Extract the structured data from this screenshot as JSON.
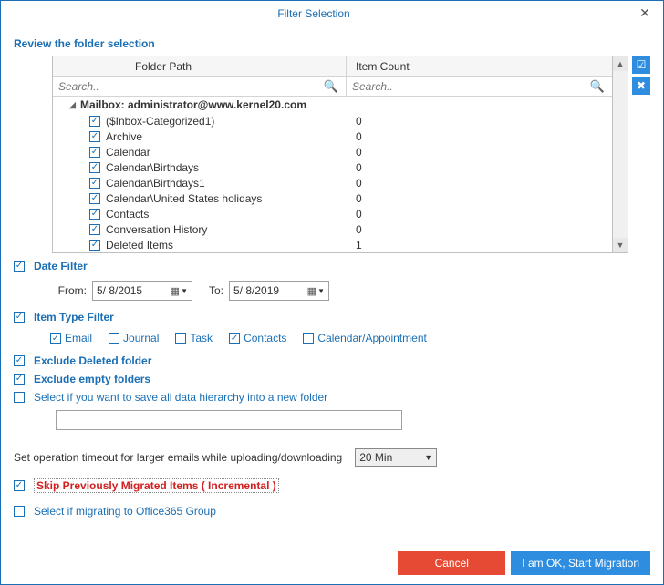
{
  "window": {
    "title": "Filter Selection"
  },
  "review": {
    "heading": "Review the folder selection",
    "columns": {
      "path": "Folder Path",
      "count": "Item Count"
    },
    "search_placeholder": "Search..",
    "mailbox": "Mailbox: administrator@www.kernel20.com",
    "folders": [
      {
        "name": "($Inbox-Categorized1)",
        "count": "0",
        "checked": true
      },
      {
        "name": "Archive",
        "count": "0",
        "checked": true
      },
      {
        "name": "Calendar",
        "count": "0",
        "checked": true
      },
      {
        "name": "Calendar\\Birthdays",
        "count": "0",
        "checked": true
      },
      {
        "name": "Calendar\\Birthdays1",
        "count": "0",
        "checked": true
      },
      {
        "name": "Calendar\\United States holidays",
        "count": "0",
        "checked": true
      },
      {
        "name": "Contacts",
        "count": "0",
        "checked": true
      },
      {
        "name": "Conversation History",
        "count": "0",
        "checked": true
      },
      {
        "name": "Deleted Items",
        "count": "1",
        "checked": true
      }
    ]
  },
  "dateFilter": {
    "label": "Date Filter",
    "checked": true,
    "from_label": "From:",
    "to_label": "To:",
    "from_value": "5/ 8/2015",
    "to_value": "5/ 8/2019"
  },
  "itemType": {
    "label": "Item Type Filter",
    "checked": true,
    "options": [
      {
        "label": "Email",
        "checked": true
      },
      {
        "label": "Journal",
        "checked": false
      },
      {
        "label": "Task",
        "checked": false
      },
      {
        "label": "Contacts",
        "checked": true
      },
      {
        "label": "Calendar/Appointment",
        "checked": false
      }
    ]
  },
  "excludeDeleted": {
    "label": "Exclude Deleted folder",
    "checked": true
  },
  "excludeEmpty": {
    "label": "Exclude empty folders",
    "checked": true
  },
  "saveHierarchy": {
    "label": "Select if you want to save all data hierarchy into a new folder",
    "checked": false,
    "value": ""
  },
  "timeout": {
    "text": "Set operation timeout for larger emails while uploading/downloading",
    "value": "20 Min"
  },
  "skipMigrated": {
    "label": "Skip Previously Migrated Items ( Incremental )",
    "checked": true
  },
  "o365group": {
    "label": "Select if migrating to Office365 Group",
    "checked": false
  },
  "buttons": {
    "cancel": "Cancel",
    "ok": "I am OK, Start Migration"
  }
}
